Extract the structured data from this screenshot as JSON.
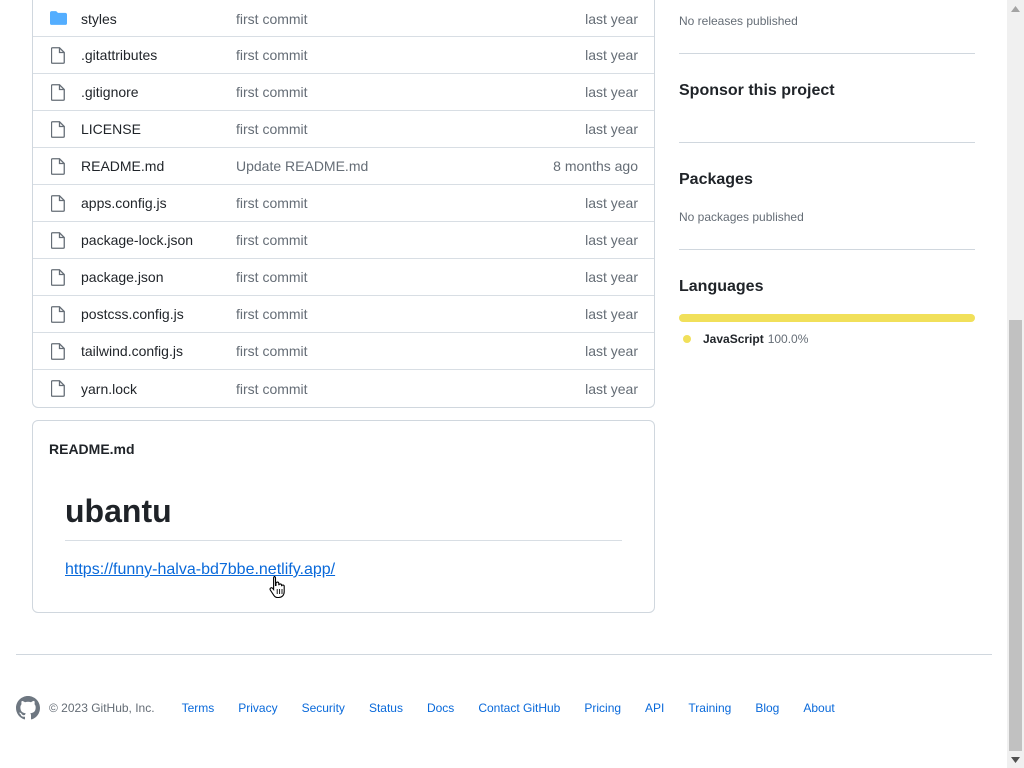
{
  "files": [
    {
      "name": "styles",
      "commit": "first commit",
      "date": "last year",
      "type": "folder"
    },
    {
      "name": ".gitattributes",
      "commit": "first commit",
      "date": "last year",
      "type": "file"
    },
    {
      "name": ".gitignore",
      "commit": "first commit",
      "date": "last year",
      "type": "file"
    },
    {
      "name": "LICENSE",
      "commit": "first commit",
      "date": "last year",
      "type": "file"
    },
    {
      "name": "README.md",
      "commit": "Update README.md",
      "date": "8 months ago",
      "type": "file"
    },
    {
      "name": "apps.config.js",
      "commit": "first commit",
      "date": "last year",
      "type": "file"
    },
    {
      "name": "package-lock.json",
      "commit": "first commit",
      "date": "last year",
      "type": "file"
    },
    {
      "name": "package.json",
      "commit": "first commit",
      "date": "last year",
      "type": "file"
    },
    {
      "name": "postcss.config.js",
      "commit": "first commit",
      "date": "last year",
      "type": "file"
    },
    {
      "name": "tailwind.config.js",
      "commit": "first commit",
      "date": "last year",
      "type": "file"
    },
    {
      "name": "yarn.lock",
      "commit": "first commit",
      "date": "last year",
      "type": "file"
    }
  ],
  "readme": {
    "title": "README.md",
    "heading": "ubantu",
    "link": "https://funny-halva-bd7bbe.netlify.app/"
  },
  "sidebar": {
    "releases_text": "No releases published",
    "sponsor_heading": "Sponsor this project",
    "packages_heading": "Packages",
    "packages_text": "No packages published",
    "languages_heading": "Languages",
    "language": {
      "name": "JavaScript",
      "percent": "100.0%",
      "share": 1.0,
      "color": "#f1e05a"
    }
  },
  "footer": {
    "copyright": "© 2023 GitHub, Inc.",
    "links": [
      "Terms",
      "Privacy",
      "Security",
      "Status",
      "Docs",
      "Contact GitHub",
      "Pricing",
      "API",
      "Training",
      "Blog",
      "About"
    ]
  },
  "colors": {
    "link": "#0969da",
    "folder": "#54aeff",
    "muted": "#656d76"
  }
}
